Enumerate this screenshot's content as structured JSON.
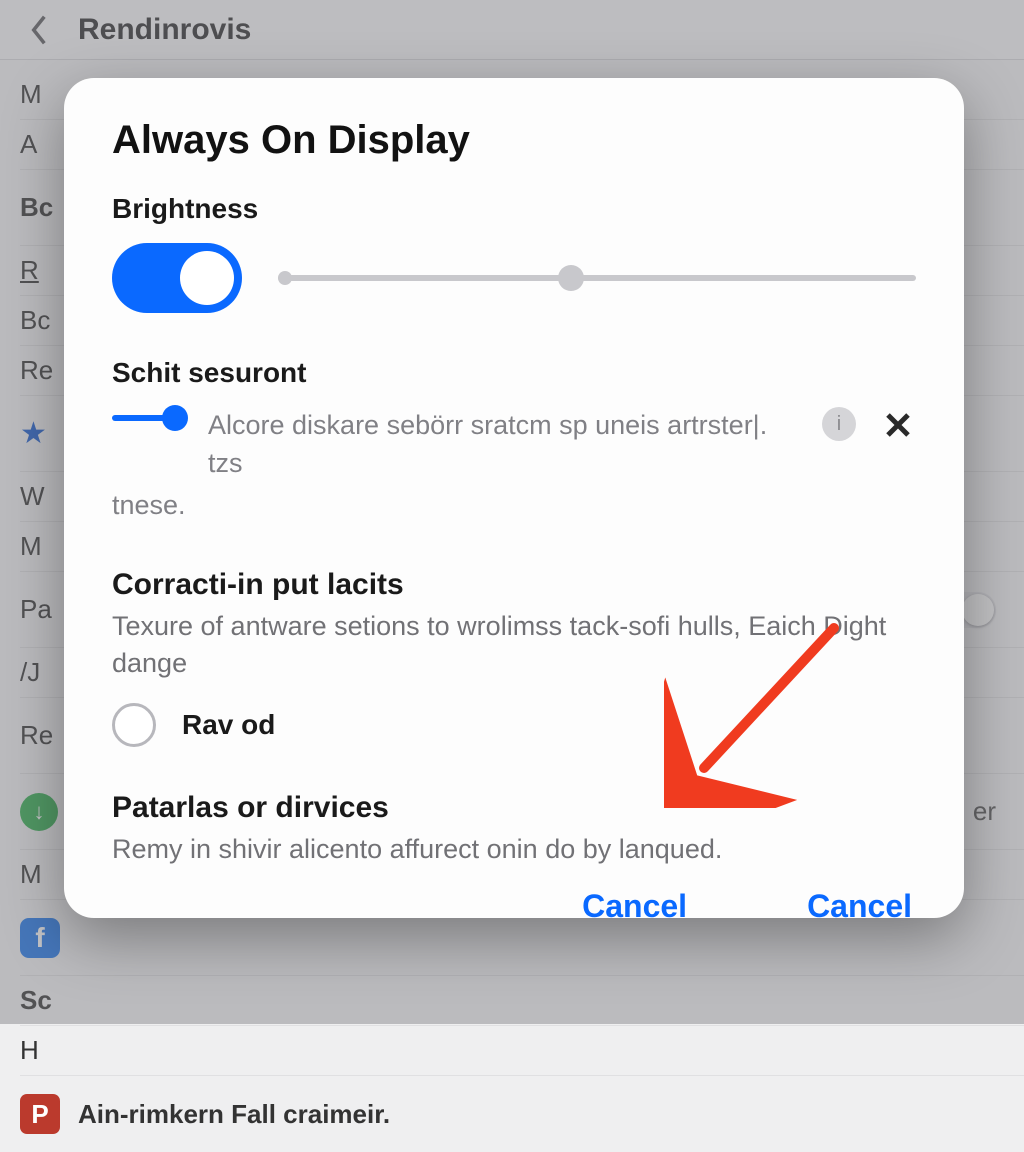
{
  "header": {
    "title": "Rendinrovis"
  },
  "bg": {
    "rows": [
      {
        "label": "M"
      },
      {
        "label": "A"
      },
      {
        "label": "Bc"
      },
      {
        "label": "R"
      },
      {
        "label": "Bc"
      },
      {
        "label": "Re"
      },
      {
        "label": "W"
      },
      {
        "label": "M"
      },
      {
        "label": "Pa"
      },
      {
        "label": "/J"
      },
      {
        "label": "Re"
      },
      {
        "label": "er"
      },
      {
        "label": "M"
      },
      {
        "label": "Sc"
      },
      {
        "label": "H"
      }
    ],
    "last_item": "Ain-rimkern Fall craimeir."
  },
  "modal": {
    "title": "Always On Display",
    "brightness_label": "Brightness",
    "brightness_on": true,
    "brightness_value": 46,
    "schit_label": "Schit sesuront",
    "schit_hint_line1": "Alcore diskare sebörr sratcm sp uneis artrster|. tzs",
    "schit_hint_line2": "tnese.",
    "corract": {
      "heading": "Corracti-in put lacits",
      "desc": "Texure of antware setions to wrolimss tack-sofi hulls, Eaich Dight dange",
      "radio_label": "Rav od"
    },
    "patarias": {
      "heading": "Patarlas or dirvices",
      "desc": "Remy in shivir alicento affurect onin do by lanqued."
    },
    "footer": {
      "cancel_left": "Cancel",
      "cancel_right": "Cancel"
    }
  }
}
